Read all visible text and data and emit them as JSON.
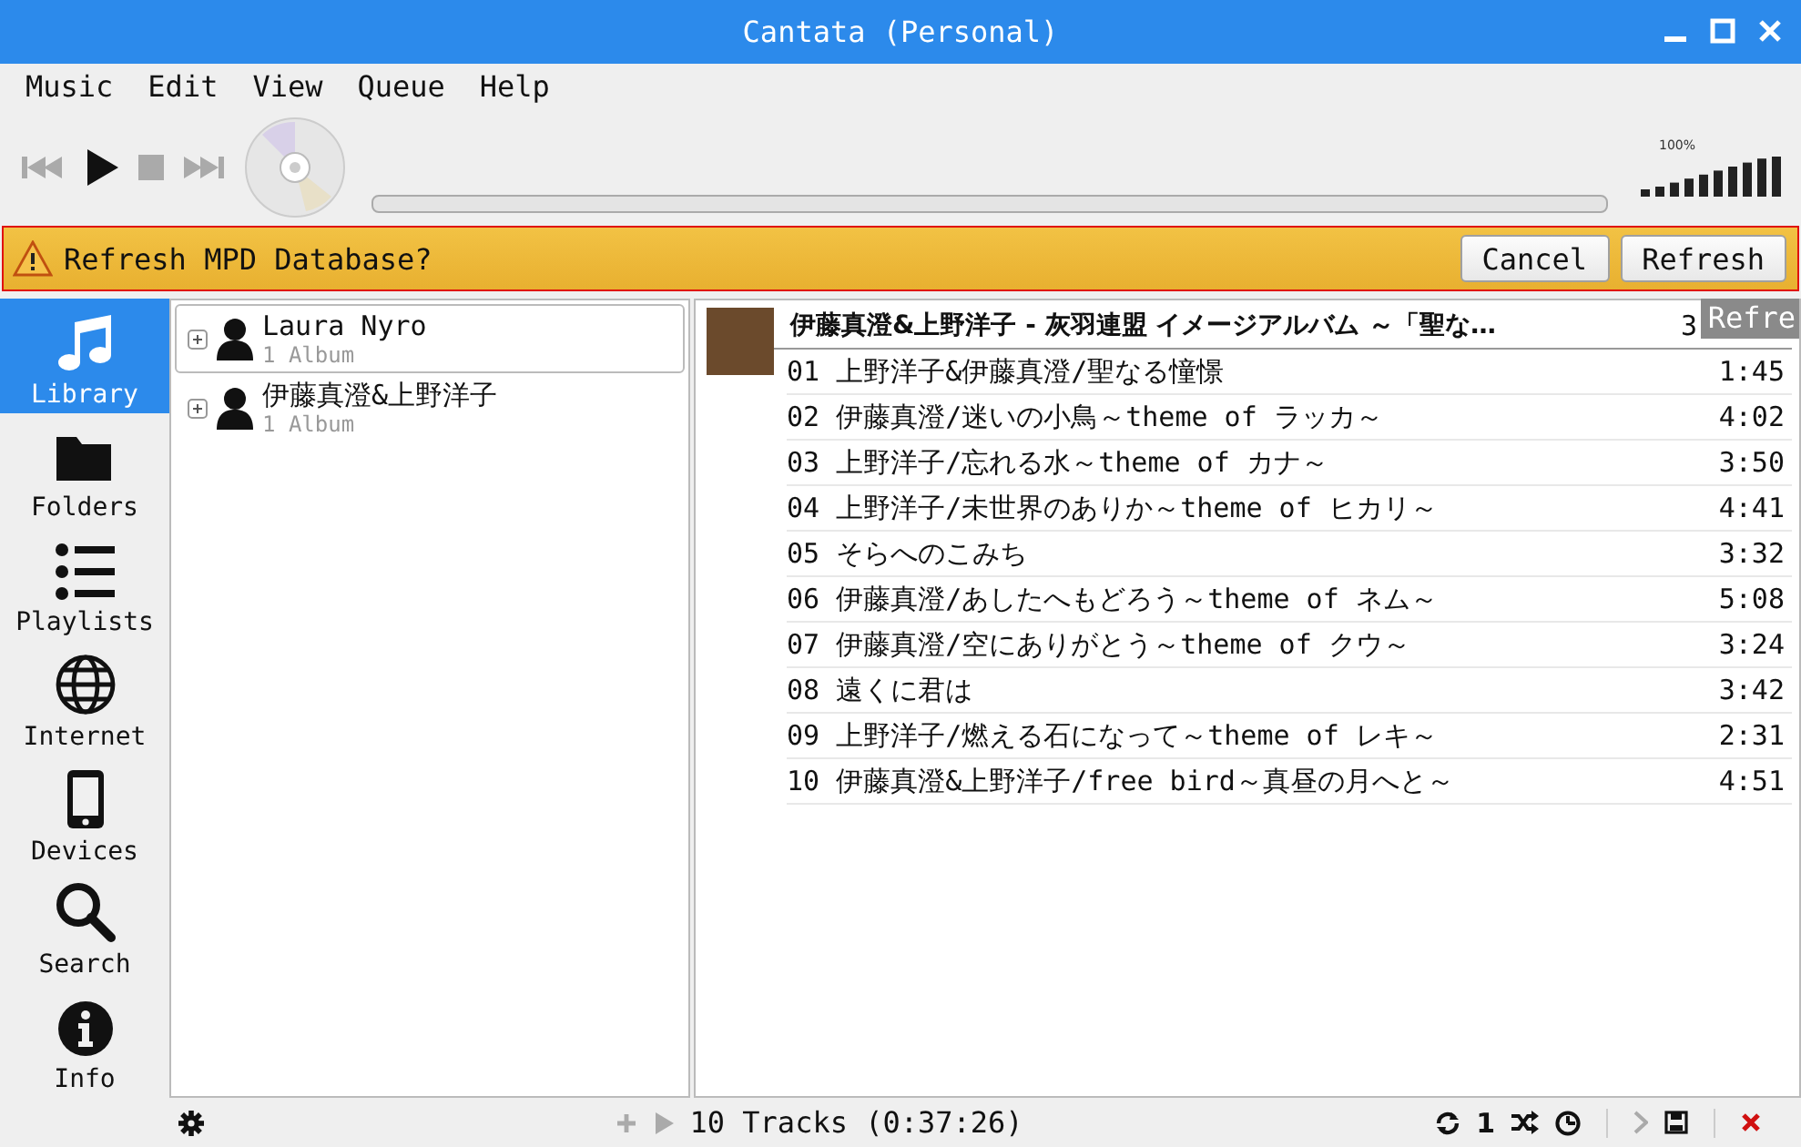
{
  "window": {
    "title": "Cantata (Personal)"
  },
  "menu": [
    "Music",
    "Edit",
    "View",
    "Queue",
    "Help"
  ],
  "toolbar": {
    "progress": {
      "level": 0
    },
    "volume": {
      "reading": "100%",
      "level": 1
    }
  },
  "banner": {
    "message": "Refresh MPD Database?",
    "buttons": [
      "Cancel",
      "Refresh"
    ],
    "tooltip": "Refre"
  },
  "sidebar": {
    "items": [
      {
        "label": "Library",
        "kind": "music",
        "selected": true
      },
      {
        "label": "Folders",
        "kind": "folder",
        "selected": false
      },
      {
        "label": "Playlists",
        "kind": "list",
        "selected": false
      },
      {
        "label": "Internet",
        "kind": "globe",
        "selected": false
      },
      {
        "label": "Devices",
        "kind": "phone",
        "selected": false
      },
      {
        "label": "Search",
        "kind": "search",
        "selected": false
      },
      {
        "label": "Info",
        "kind": "info",
        "selected": false
      }
    ]
  },
  "library": {
    "artists": [
      {
        "name": "Laura Nyro",
        "count": "1 Album",
        "selected": true
      },
      {
        "name": "伊藤真澄&上野洋子",
        "count": "1 Album",
        "selected": false
      }
    ]
  },
  "playqueue": {
    "album_header": "伊藤真澄&上野洋子 - 灰羽連盟 イメージアルバム ～「聖な…",
    "header_duration": "3",
    "tracks": [
      {
        "title": "01 上野洋子&伊藤真澄/聖なる憧憬",
        "duration": "1:45"
      },
      {
        "title": "02 伊藤真澄/迷いの小鳥～theme of ラッカ～",
        "duration": "4:02"
      },
      {
        "title": "03 上野洋子/忘れる水～theme of カナ～",
        "duration": "3:50"
      },
      {
        "title": "04 上野洋子/未世界のありか～theme of ヒカリ～",
        "duration": "4:41"
      },
      {
        "title": "05 そらへのこみち",
        "duration": "3:32"
      },
      {
        "title": "06 伊藤真澄/あしたへもどろう～theme of ネム～",
        "duration": "5:08"
      },
      {
        "title": "07 伊藤真澄/空にありがとう～theme of クウ～",
        "duration": "3:24"
      },
      {
        "title": "08 遠くに君は",
        "duration": "3:42"
      },
      {
        "title": "09 上野洋子/燃える石になって～theme of レキ～",
        "duration": "2:31"
      },
      {
        "title": "10 伊藤真澄&上野洋子/free bird～真昼の月へと～",
        "duration": "4:51"
      }
    ]
  },
  "status_bar": {
    "summary": "10 Tracks (0:37:26)",
    "single": "1"
  }
}
